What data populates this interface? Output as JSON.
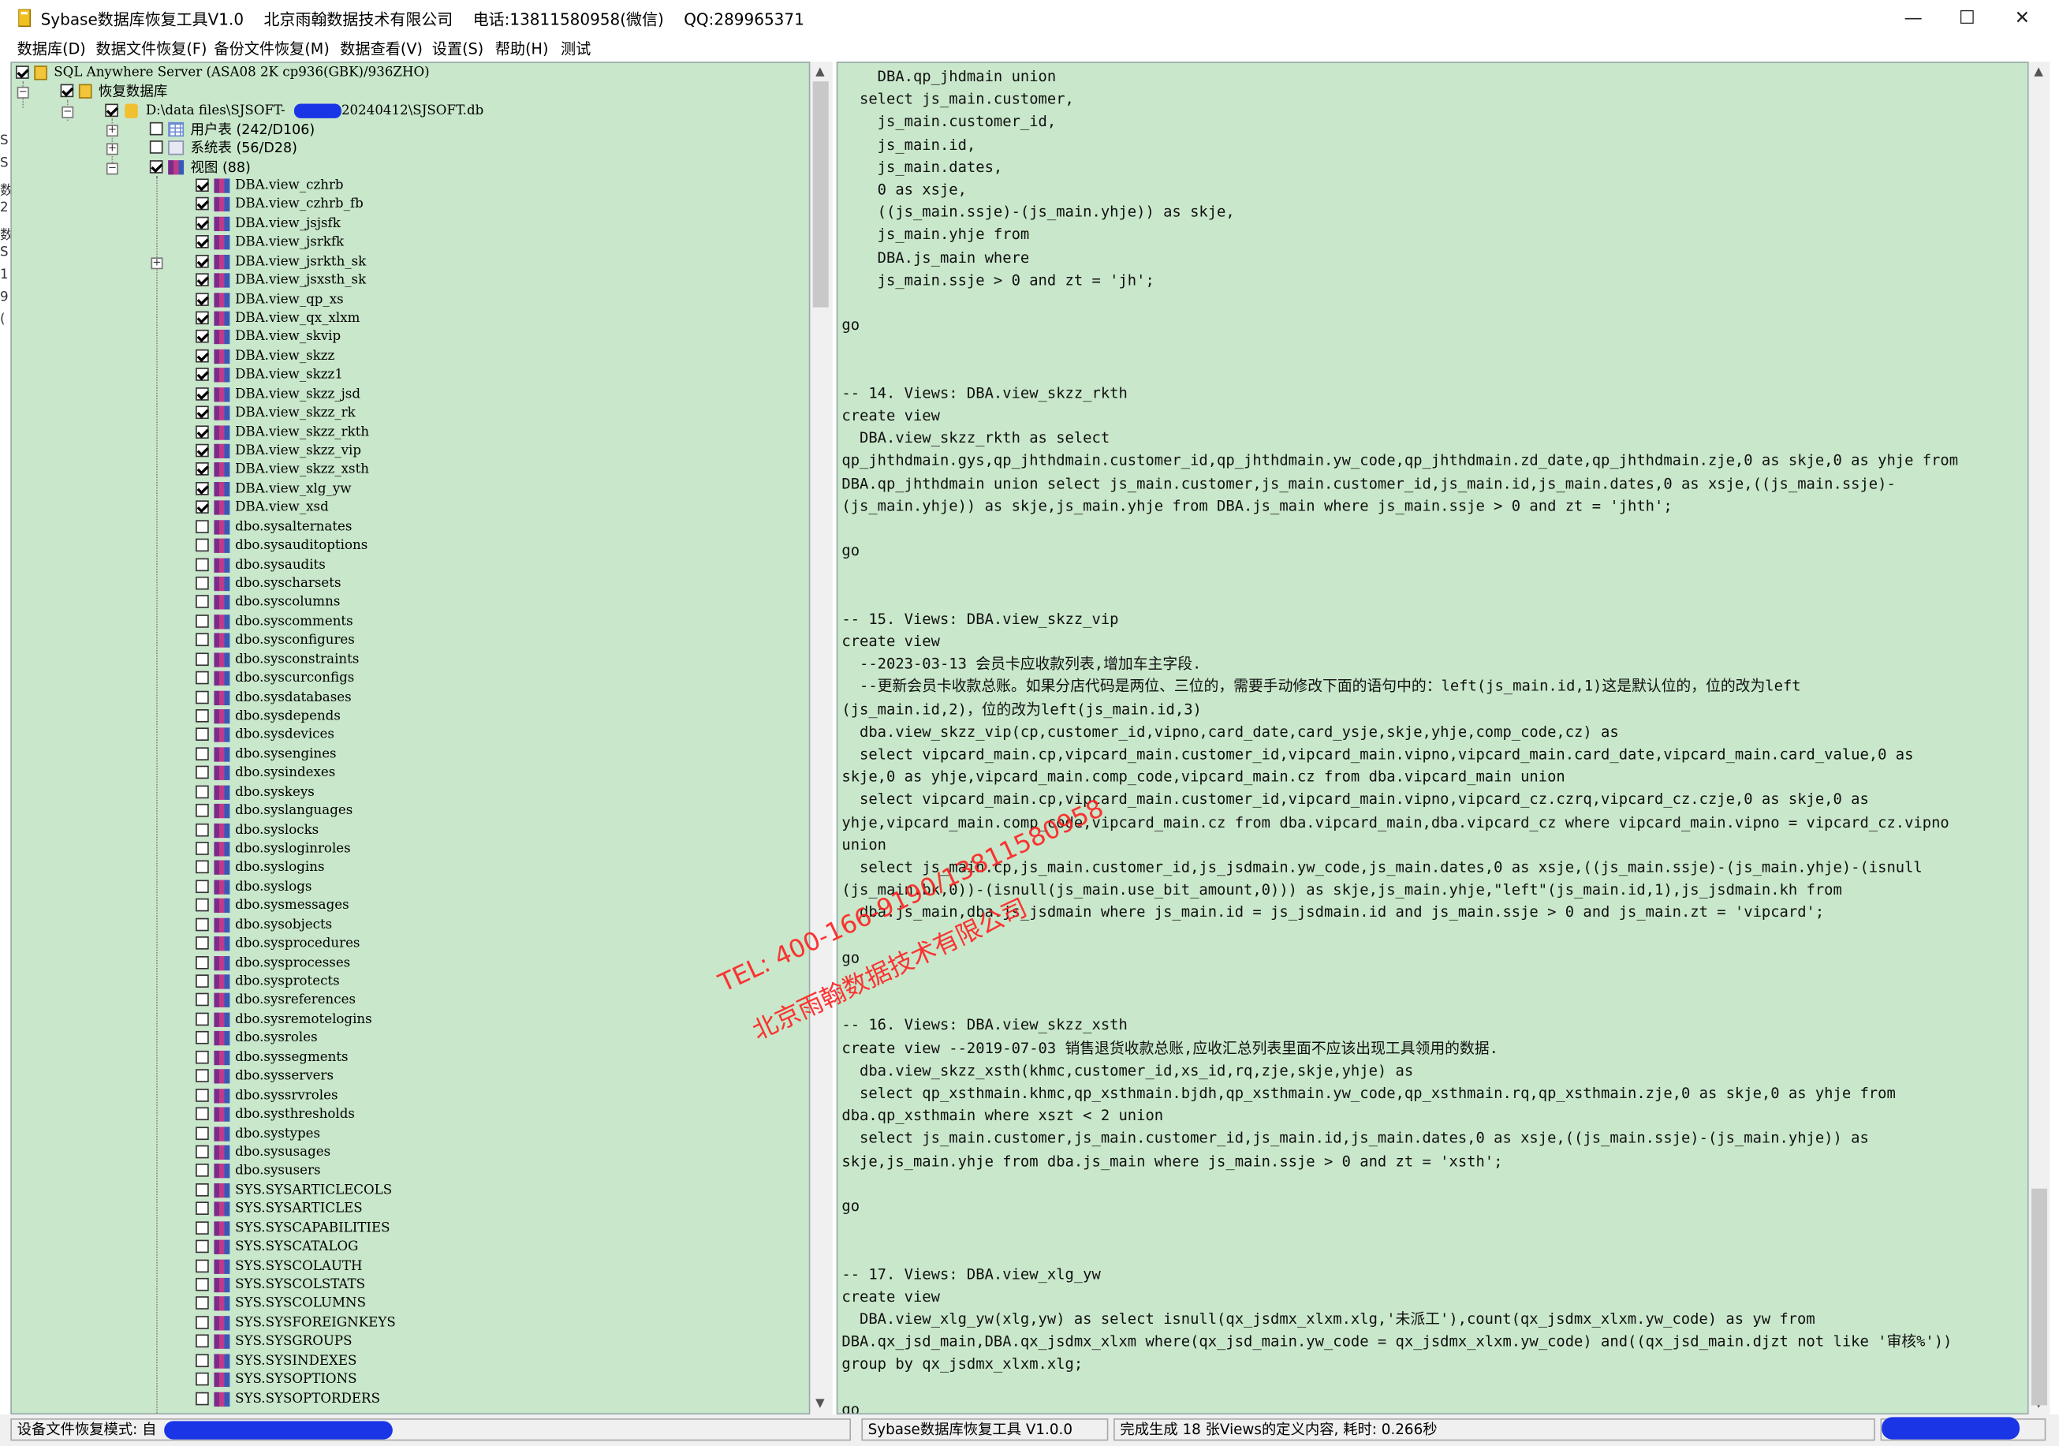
{
  "window": {
    "title": "Sybase数据库恢复工具V1.0    北京雨翰数据技术有限公司    电话:13811580958(微信)    QQ:289965371",
    "controls": {
      "minimize": "—",
      "maximize": "☐",
      "close": "✕"
    }
  },
  "menu": [
    "数据库(D)",
    "数据文件恢复(F)",
    "备份文件恢复(M)",
    "数据查看(V)",
    "设置(S)",
    "帮助(H)",
    "测试"
  ],
  "left_edge_fragments": [
    "S",
    "S",
    "数",
    "2",
    "数",
    "S",
    "1",
    "9",
    "("
  ],
  "tree": {
    "server": "SQL Anywhere Server  (ASA08 2K cp936(GBK)/936ZHO)",
    "recovered": "恢复数据库",
    "file_prefix": "D:\\data files\\SJSOFT-",
    "file_suffix": "20240412\\SJSOFT.db",
    "user_tables": "用户表 (242/D106)",
    "system_tables": "系统表 (56/D28)",
    "views_folder": "视图 (88)",
    "views": [
      {
        "name": "DBA.view_czhrb",
        "checked": true
      },
      {
        "name": "DBA.view_czhrb_fb",
        "checked": true
      },
      {
        "name": "DBA.view_jsjsfk",
        "checked": true
      },
      {
        "name": "DBA.view_jsrkfk",
        "checked": true
      },
      {
        "name": "DBA.view_jsrkth_sk",
        "checked": true,
        "expand": true
      },
      {
        "name": "DBA.view_jsxsth_sk",
        "checked": true
      },
      {
        "name": "DBA.view_qp_xs",
        "checked": true
      },
      {
        "name": "DBA.view_qx_xlxm",
        "checked": true
      },
      {
        "name": "DBA.view_skvip",
        "checked": true
      },
      {
        "name": "DBA.view_skzz",
        "checked": true
      },
      {
        "name": "DBA.view_skzz1",
        "checked": true
      },
      {
        "name": "DBA.view_skzz_jsd",
        "checked": true
      },
      {
        "name": "DBA.view_skzz_rk",
        "checked": true
      },
      {
        "name": "DBA.view_skzz_rkth",
        "checked": true
      },
      {
        "name": "DBA.view_skzz_vip",
        "checked": true
      },
      {
        "name": "DBA.view_skzz_xsth",
        "checked": true
      },
      {
        "name": "DBA.view_xlg_yw",
        "checked": true
      },
      {
        "name": "DBA.view_xsd",
        "checked": true
      },
      {
        "name": "dbo.sysalternates",
        "checked": false
      },
      {
        "name": "dbo.sysauditoptions",
        "checked": false
      },
      {
        "name": "dbo.sysaudits",
        "checked": false
      },
      {
        "name": "dbo.syscharsets",
        "checked": false
      },
      {
        "name": "dbo.syscolumns",
        "checked": false
      },
      {
        "name": "dbo.syscomments",
        "checked": false
      },
      {
        "name": "dbo.sysconfigures",
        "checked": false
      },
      {
        "name": "dbo.sysconstraints",
        "checked": false
      },
      {
        "name": "dbo.syscurconfigs",
        "checked": false
      },
      {
        "name": "dbo.sysdatabases",
        "checked": false
      },
      {
        "name": "dbo.sysdepends",
        "checked": false
      },
      {
        "name": "dbo.sysdevices",
        "checked": false
      },
      {
        "name": "dbo.sysengines",
        "checked": false
      },
      {
        "name": "dbo.sysindexes",
        "checked": false
      },
      {
        "name": "dbo.syskeys",
        "checked": false
      },
      {
        "name": "dbo.syslanguages",
        "checked": false
      },
      {
        "name": "dbo.syslocks",
        "checked": false
      },
      {
        "name": "dbo.sysloginroles",
        "checked": false
      },
      {
        "name": "dbo.syslogins",
        "checked": false
      },
      {
        "name": "dbo.syslogs",
        "checked": false
      },
      {
        "name": "dbo.sysmessages",
        "checked": false
      },
      {
        "name": "dbo.sysobjects",
        "checked": false
      },
      {
        "name": "dbo.sysprocedures",
        "checked": false
      },
      {
        "name": "dbo.sysprocesses",
        "checked": false
      },
      {
        "name": "dbo.sysprotects",
        "checked": false
      },
      {
        "name": "dbo.sysreferences",
        "checked": false
      },
      {
        "name": "dbo.sysremotelogins",
        "checked": false
      },
      {
        "name": "dbo.sysroles",
        "checked": false
      },
      {
        "name": "dbo.syssegments",
        "checked": false
      },
      {
        "name": "dbo.sysservers",
        "checked": false
      },
      {
        "name": "dbo.syssrvroles",
        "checked": false
      },
      {
        "name": "dbo.systhresholds",
        "checked": false
      },
      {
        "name": "dbo.systypes",
        "checked": false
      },
      {
        "name": "dbo.sysusages",
        "checked": false
      },
      {
        "name": "dbo.sysusers",
        "checked": false
      },
      {
        "name": "SYS.SYSARTICLECOLS",
        "checked": false
      },
      {
        "name": "SYS.SYSARTICLES",
        "checked": false
      },
      {
        "name": "SYS.SYSCAPABILITIES",
        "checked": false
      },
      {
        "name": "SYS.SYSCATALOG",
        "checked": false
      },
      {
        "name": "SYS.SYSCOLAUTH",
        "checked": false
      },
      {
        "name": "SYS.SYSCOLSTATS",
        "checked": false
      },
      {
        "name": "SYS.SYSCOLUMNS",
        "checked": false
      },
      {
        "name": "SYS.SYSFOREIGNKEYS",
        "checked": false
      },
      {
        "name": "SYS.SYSGROUPS",
        "checked": false
      },
      {
        "name": "SYS.SYSINDEXES",
        "checked": false
      },
      {
        "name": "SYS.SYSOPTIONS",
        "checked": false
      },
      {
        "name": "SYS.SYSOPTORDERS",
        "checked": false
      }
    ]
  },
  "editor": {
    "lines": [
      "    DBA.qp_jhdmain union",
      "  select js_main.customer,",
      "    js_main.customer_id,",
      "    js_main.id,",
      "    js_main.dates,",
      "    0 as xsje,",
      "    ((js_main.ssje)-(js_main.yhje)) as skje,",
      "    js_main.yhje from",
      "    DBA.js_main where",
      "    js_main.ssje > 0 and zt = 'jh';",
      "",
      "go",
      "",
      "",
      "-- 14. Views: DBA.view_skzz_rkth",
      "create view",
      "  DBA.view_skzz_rkth as select",
      "qp_jhthdmain.gys,qp_jhthdmain.customer_id,qp_jhthdmain.yw_code,qp_jhthdmain.zd_date,qp_jhthdmain.zje,0 as skje,0 as yhje from",
      "DBA.qp_jhthdmain union select js_main.customer,js_main.customer_id,js_main.id,js_main.dates,0 as xsje,((js_main.ssje)-",
      "(js_main.yhje)) as skje,js_main.yhje from DBA.js_main where js_main.ssje > 0 and zt = 'jhth';",
      "",
      "go",
      "",
      "",
      "-- 15. Views: DBA.view_skzz_vip",
      "create view",
      "  --2023-03-13 会员卡应收款列表,增加车主字段.",
      "  --更新会员卡收款总账。如果分店代码是两位、三位的，需要手动修改下面的语句中的：left(js_main.id,1)这是默认位的，位的改为left",
      "(js_main.id,2)，位的改为left(js_main.id,3)",
      "  dba.view_skzz_vip(cp,customer_id,vipno,card_date,card_ysje,skje,yhje,comp_code,cz) as",
      "  select vipcard_main.cp,vipcard_main.customer_id,vipcard_main.vipno,vipcard_main.card_date,vipcard_main.card_value,0 as",
      "skje,0 as yhje,vipcard_main.comp_code,vipcard_main.cz from dba.vipcard_main union",
      "  select vipcard_main.cp,vipcard_main.customer_id,vipcard_main.vipno,vipcard_cz.czrq,vipcard_cz.czje,0 as skje,0 as",
      "yhje,vipcard_main.comp_code,vipcard_main.cz from dba.vipcard_main,dba.vipcard_cz where vipcard_main.vipno = vipcard_cz.vipno",
      "union",
      "  select js_main.cp,js_main.customer_id,js_jsdmain.yw_code,js_main.dates,0 as xsje,((js_main.ssje)-(js_main.yhje)-(isnull",
      "(js_main.bk,0))-(isnull(js_main.use_bit_amount,0))) as skje,js_main.yhje,\"left\"(js_main.id,1),js_jsdmain.kh from",
      "  dba.js_main,dba.js_jsdmain where js_main.id = js_jsdmain.id and js_main.ssje > 0 and js_main.zt = 'vipcard';",
      "",
      "go",
      "",
      "",
      "-- 16. Views: DBA.view_skzz_xsth",
      "create view --2019-07-03 销售退货收款总账,应收汇总列表里面不应该出现工具领用的数据.",
      "  dba.view_skzz_xsth(khmc,customer_id,xs_id,rq,zje,skje,yhje) as",
      "  select qp_xsthmain.khmc,qp_xsthmain.bjdh,qp_xsthmain.yw_code,qp_xsthmain.rq,qp_xsthmain.zje,0 as skje,0 as yhje from",
      "dba.qp_xsthmain where xszt < 2 union",
      "  select js_main.customer,js_main.customer_id,js_main.id,js_main.dates,0 as xsje,((js_main.ssje)-(js_main.yhje)) as",
      "skje,js_main.yhje from dba.js_main where js_main.ssje > 0 and zt = 'xsth';",
      "",
      "go",
      "",
      "",
      "-- 17. Views: DBA.view_xlg_yw",
      "create view",
      "  DBA.view_xlg_yw(xlg,yw) as select isnull(qx_jsdmx_xlxm.xlg,'未派工'),count(qx_jsdmx_xlxm.yw_code) as yw from",
      "DBA.qx_jsd_main,DBA.qx_jsdmx_xlxm where(qx_jsd_main.yw_code = qx_jsdmx_xlxm.yw_code) and((qx_jsd_main.djzt not like '审核%'))",
      "group by qx_jsdmx_xlxm.xlg;",
      "",
      "go"
    ]
  },
  "watermark": {
    "line1": "TEL: 400-166-9190/13811580958",
    "line2": "北京雨翰数据技术有限公司"
  },
  "status": {
    "mode": "设备文件恢复模式: 自",
    "app": "Sybase数据库恢复工具 V1.0.0",
    "result": "完成生成 18 张Views的定义内容, 耗时: 0.266秒"
  }
}
